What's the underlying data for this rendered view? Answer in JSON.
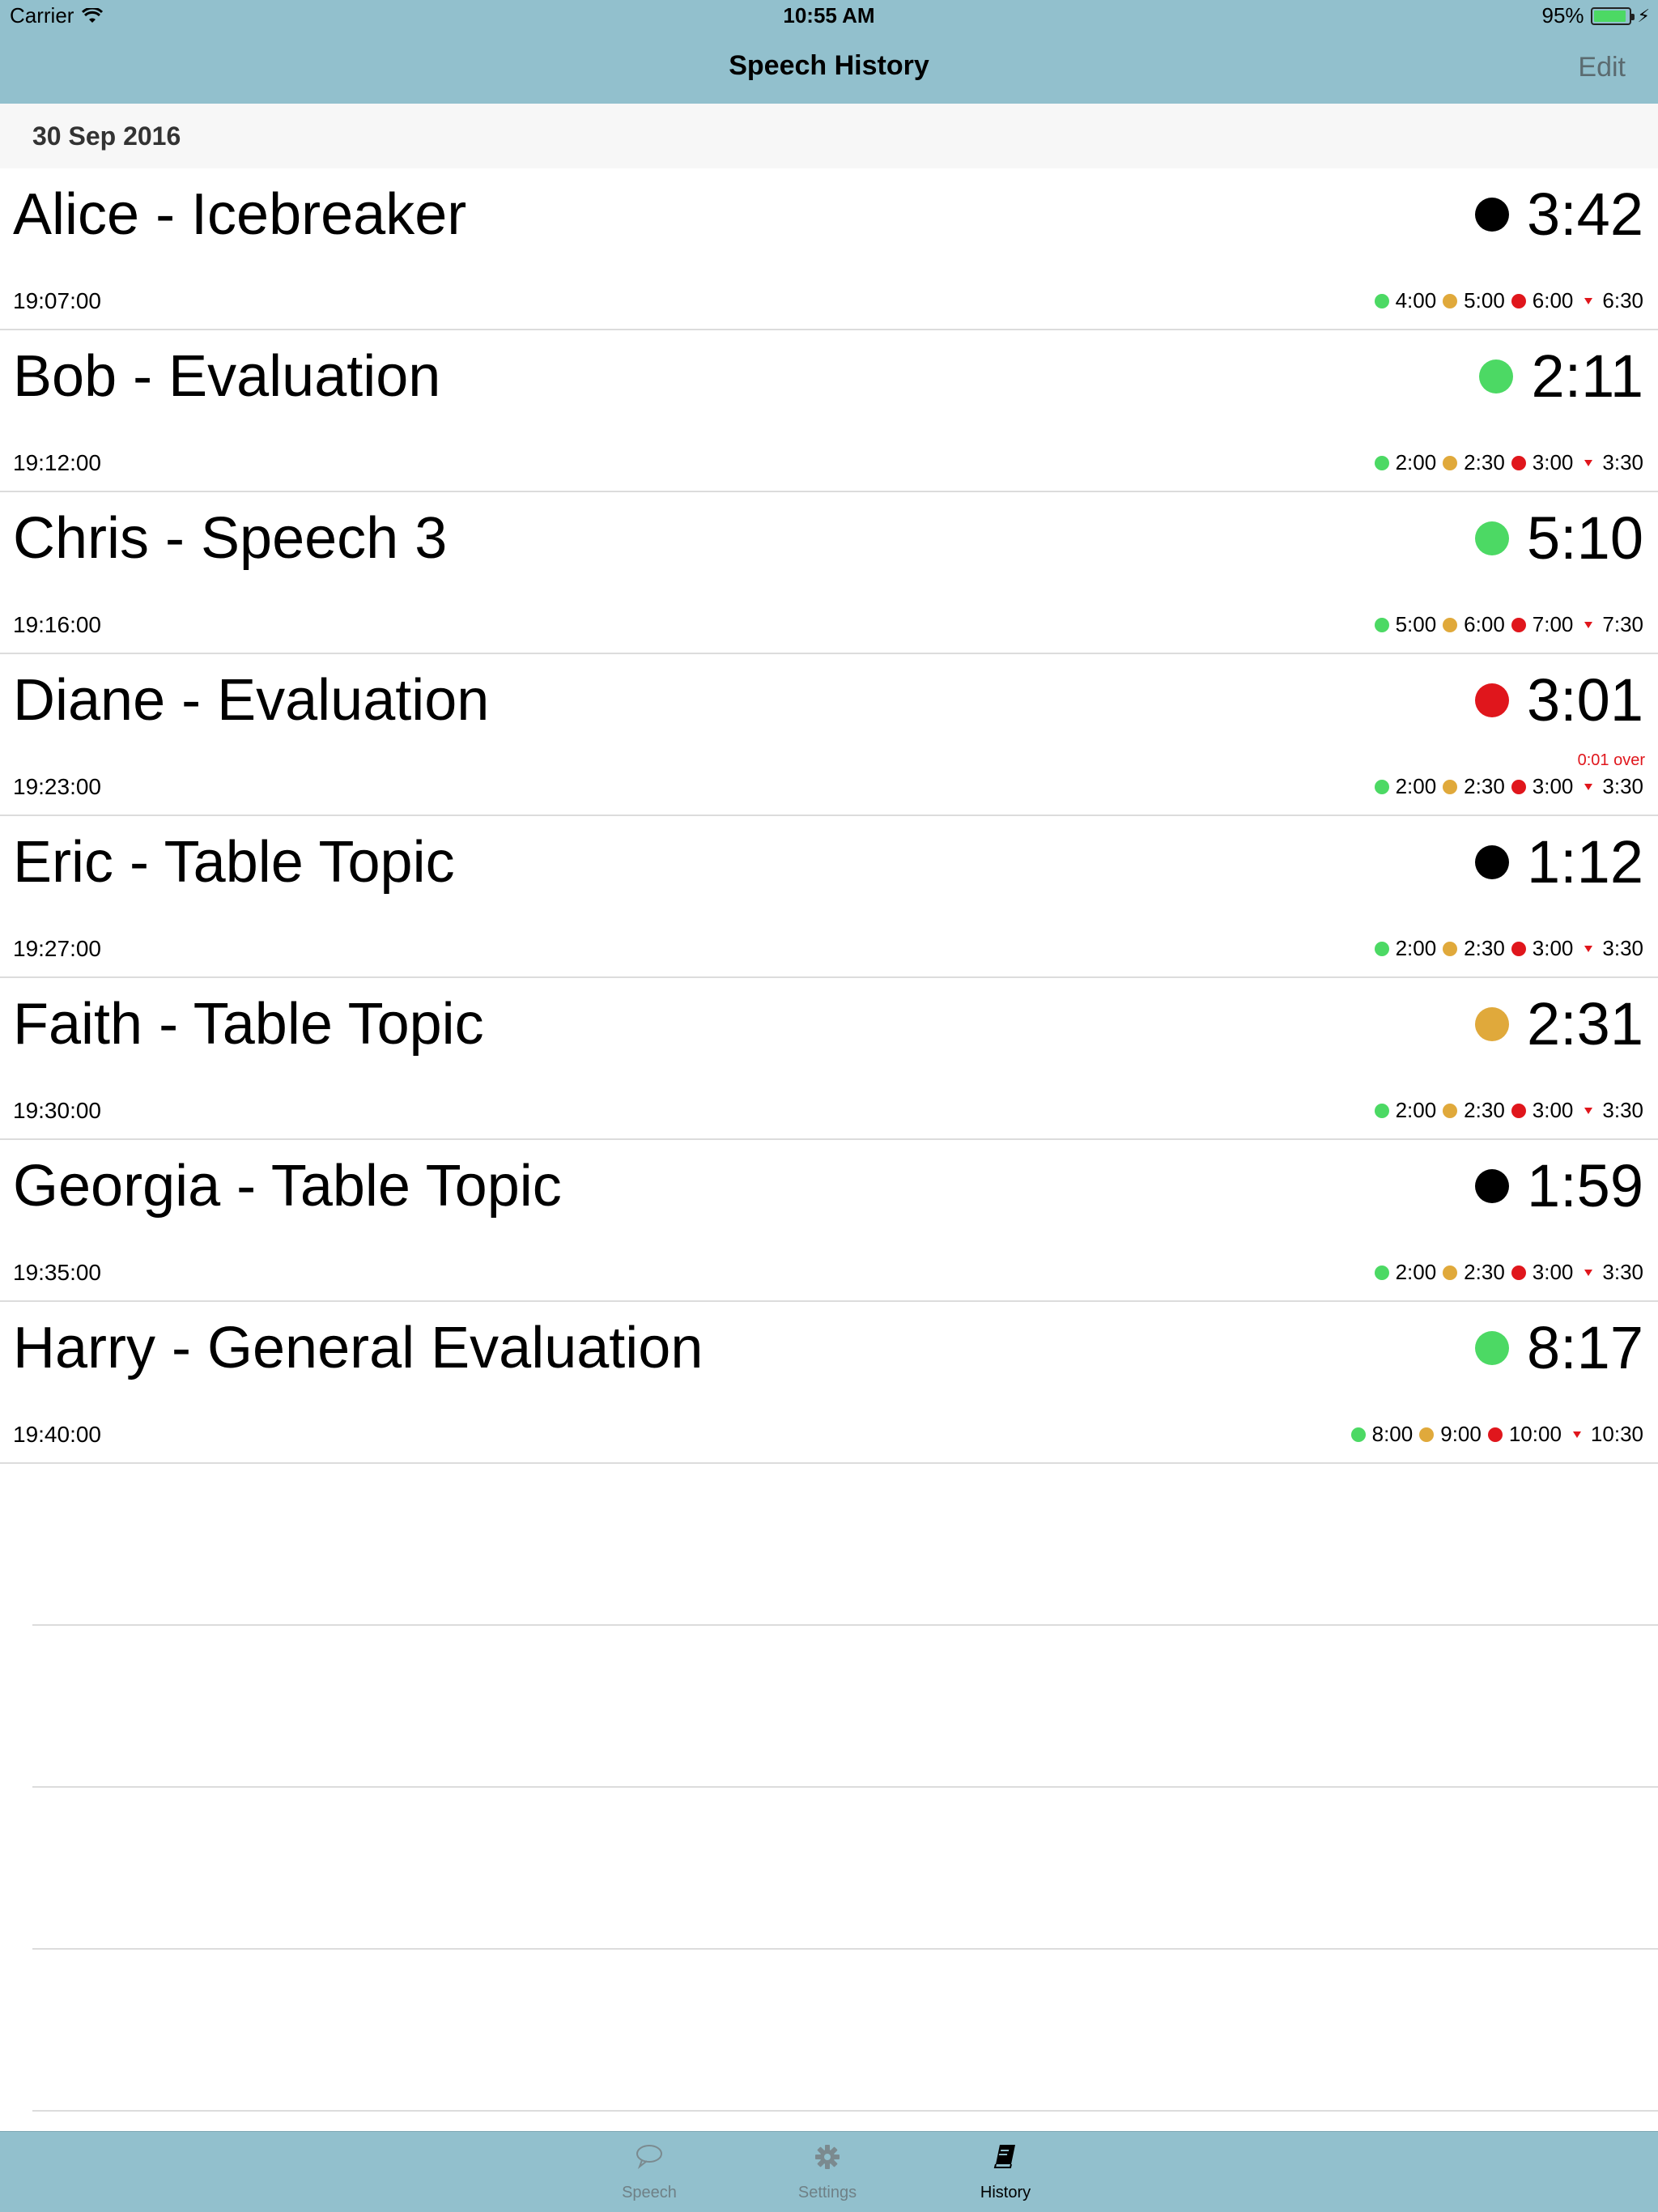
{
  "status_bar": {
    "carrier": "Carrier",
    "time": "10:55 AM",
    "battery": "95%"
  },
  "nav": {
    "title": "Speech History",
    "edit": "Edit"
  },
  "section": {
    "date": "30 Sep 2016"
  },
  "colors": {
    "green": "#4cd964",
    "amber": "#e0a93b",
    "red": "#e0161c",
    "black": "#000000",
    "bar": "#92c0cd"
  },
  "speeches": [
    {
      "name": "Alice - Icebreaker",
      "start": "19:07:00",
      "duration": "3:42",
      "status": "black",
      "over": "",
      "green": "4:00",
      "amber": "5:00",
      "red": "6:00",
      "max": "6:30"
    },
    {
      "name": "Bob - Evaluation",
      "start": "19:12:00",
      "duration": "2:11",
      "status": "green",
      "over": "",
      "green": "2:00",
      "amber": "2:30",
      "red": "3:00",
      "max": "3:30"
    },
    {
      "name": "Chris - Speech 3",
      "start": "19:16:00",
      "duration": "5:10",
      "status": "green",
      "over": "",
      "green": "5:00",
      "amber": "6:00",
      "red": "7:00",
      "max": "7:30"
    },
    {
      "name": "Diane - Evaluation",
      "start": "19:23:00",
      "duration": "3:01",
      "status": "red",
      "over": "0:01 over",
      "green": "2:00",
      "amber": "2:30",
      "red": "3:00",
      "max": "3:30"
    },
    {
      "name": "Eric - Table Topic",
      "start": "19:27:00",
      "duration": "1:12",
      "status": "black",
      "over": "",
      "green": "2:00",
      "amber": "2:30",
      "red": "3:00",
      "max": "3:30"
    },
    {
      "name": "Faith - Table Topic",
      "start": "19:30:00",
      "duration": "2:31",
      "status": "amber",
      "over": "",
      "green": "2:00",
      "amber": "2:30",
      "red": "3:00",
      "max": "3:30"
    },
    {
      "name": "Georgia - Table Topic",
      "start": "19:35:00",
      "duration": "1:59",
      "status": "black",
      "over": "",
      "green": "2:00",
      "amber": "2:30",
      "red": "3:00",
      "max": "3:30"
    },
    {
      "name": "Harry - General Evaluation",
      "start": "19:40:00",
      "duration": "8:17",
      "status": "green",
      "over": "",
      "green": "8:00",
      "amber": "9:00",
      "red": "10:00",
      "max": "10:30"
    }
  ],
  "tabs": [
    {
      "label": "Speech",
      "icon": "speech-bubble-icon",
      "selected": false
    },
    {
      "label": "Settings",
      "icon": "gear-icon",
      "selected": false
    },
    {
      "label": "History",
      "icon": "book-icon",
      "selected": true
    }
  ]
}
